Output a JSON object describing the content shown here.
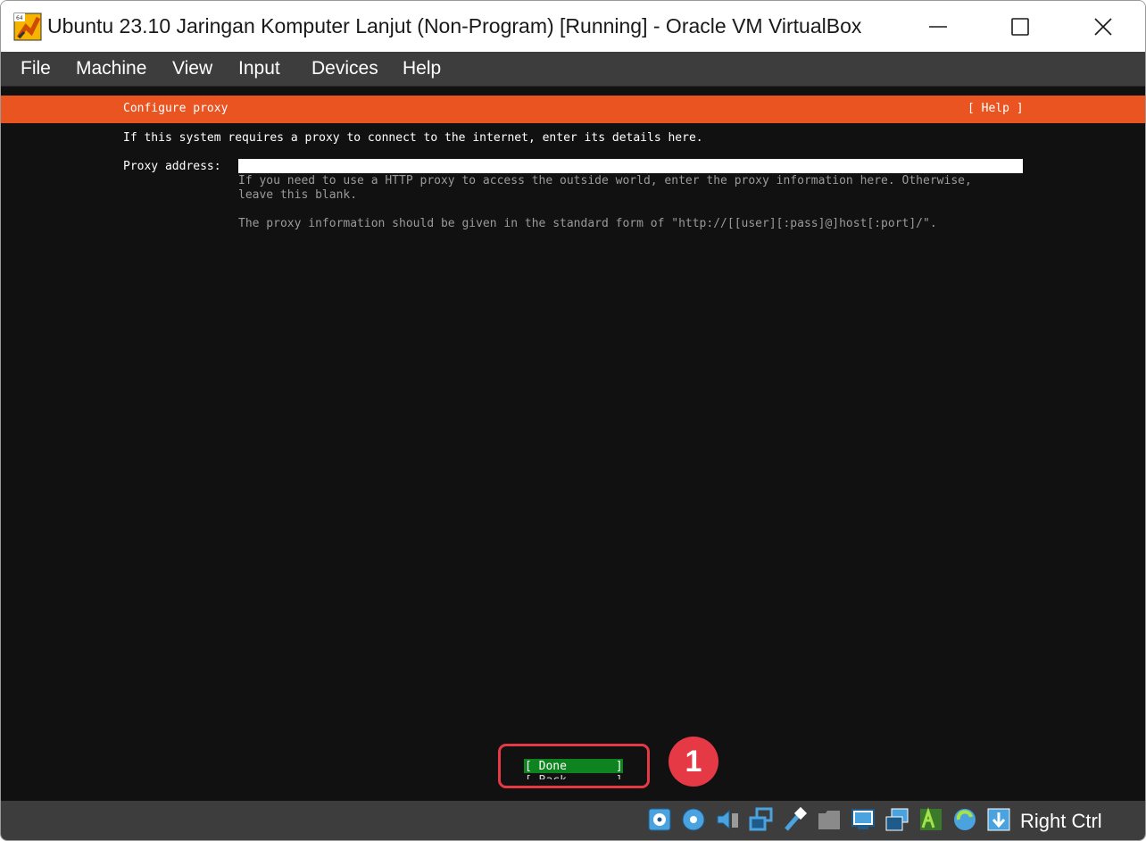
{
  "window": {
    "title": "Ubuntu 23.10 Jaringan Komputer Lanjut (Non-Program) [Running] - Oracle VM VirtualBox",
    "app_icon_badge": "64"
  },
  "menubar": {
    "items": [
      "File",
      "Machine",
      "View",
      "Input",
      "Devices",
      "Help"
    ]
  },
  "installer": {
    "header_title": "Configure proxy",
    "header_help": "[ Help ]",
    "intro": "If this system requires a proxy to connect to the internet, enter its details here.",
    "proxy_label": "Proxy address:",
    "proxy_value": "",
    "hint_line1": "If you need to use a HTTP proxy to access the outside world, enter the proxy information here. Otherwise,",
    "hint_line2": "leave this blank.",
    "hint_line3": "The proxy information should be given in the standard form of \"http://[[user][:pass]@]host[:port]/\".",
    "done_button": "[ Done       ]",
    "back_button": "[ Back       ]",
    "accent_color": "#e95420",
    "done_color": "#0e8420"
  },
  "annotation": {
    "step_number": "1",
    "color": "#e53945"
  },
  "statusbar": {
    "icons": [
      "hard-disk-icon",
      "optical-drive-icon",
      "audio-icon",
      "network-icon",
      "usb-icon",
      "shared-folder-icon",
      "display-icon",
      "screen-capture-icon",
      "graphics-3d-icon",
      "cpu-state-icon",
      "mouse-integration-icon"
    ],
    "host_key": "Right Ctrl"
  }
}
